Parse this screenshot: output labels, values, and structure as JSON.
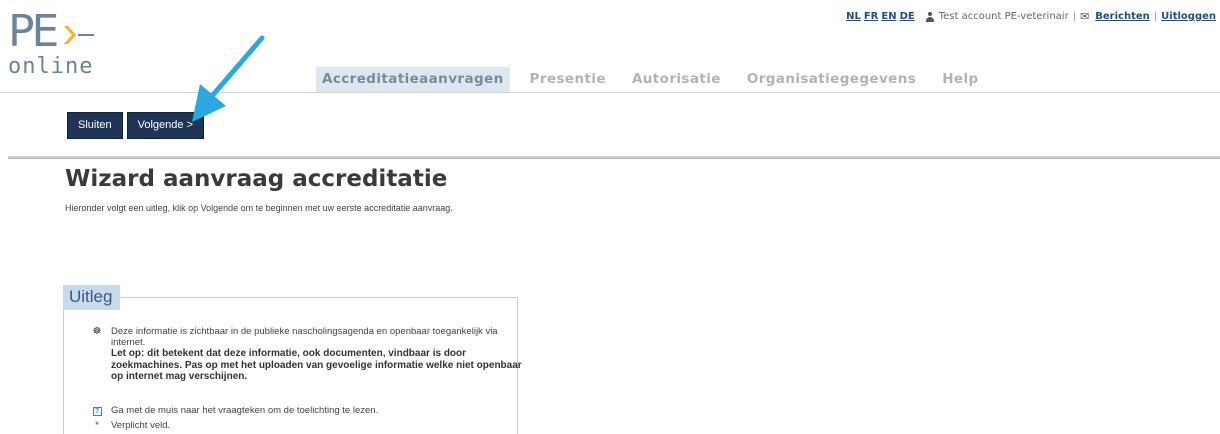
{
  "logo": {
    "top": "PE",
    "bottom": "online"
  },
  "util": {
    "languages": [
      "NL",
      "FR",
      "EN",
      "DE"
    ],
    "user": "Test account PE-veterinair",
    "messages": "Berichten",
    "logout": "Uitloggen",
    "separator": "|"
  },
  "nav": {
    "items": [
      {
        "label": "Accreditatieaanvragen",
        "active": true
      },
      {
        "label": "Presentie",
        "active": false
      },
      {
        "label": "Autorisatie",
        "active": false
      },
      {
        "label": "Organisatiegegevens",
        "active": false
      },
      {
        "label": "Help",
        "active": false
      }
    ]
  },
  "toolbar": {
    "close_label": "Sluiten",
    "next_label": "Volgende >"
  },
  "page": {
    "title": "Wizard aanvraag accreditatie",
    "subtitle": "Hieronder volgt een uitleg, klik op Volgende om te beginnen met uw eerste accreditatie aanvraag."
  },
  "uitleg": {
    "legend": "Uitleg",
    "public_text": "Deze informatie is zichtbaar in de publieke nascholingsagenda en openbaar toegankelijk via internet.",
    "warning_text": "Let op: dit betekent dat deze informatie, ook documenten, vindbaar is door zoekmachines. Pas op met het uploaden van gevoelige informatie welke niet openbaar op internet mag verschijnen.",
    "help_icon_text": "?",
    "help_text": "Ga met de muis naar het vraagteken om de toelichting te lezen.",
    "required_marker": "*",
    "required_text": "Verplicht veld."
  },
  "colors": {
    "button_bg": "#1e3558",
    "nav_active_bg": "#dde7f0",
    "legend_bg": "#c8dbee",
    "arrow": "#29a9e0"
  }
}
